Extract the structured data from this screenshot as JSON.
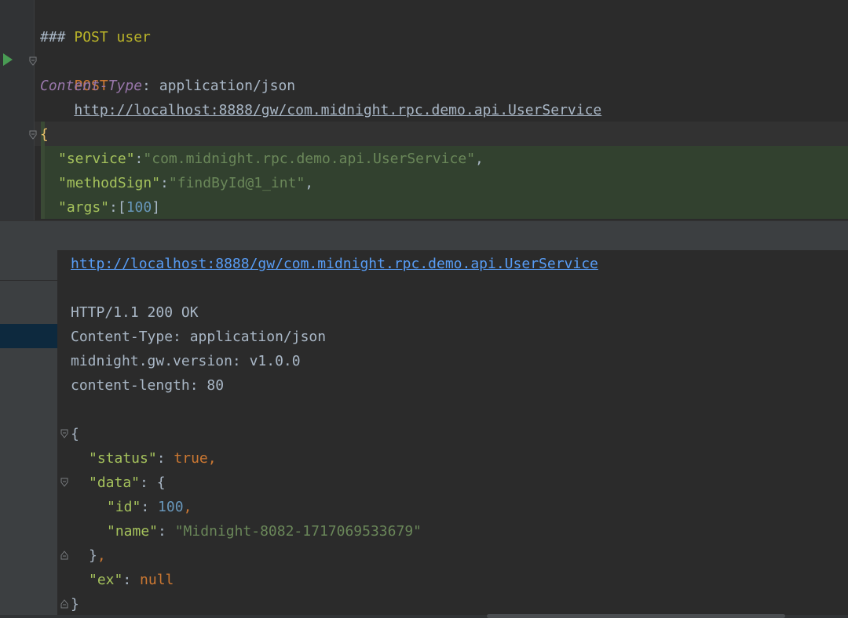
{
  "request": {
    "comment": "### POST user",
    "method": "POST",
    "url": "http://localhost:8888/gw/com.midnight.rpc.demo.api.UserService",
    "header_name": "Content-Type",
    "header_sep": ": ",
    "header_value": "application/json",
    "body_open": "{",
    "body_lines": [
      {
        "key": "\"service\"",
        "sep": ":",
        "value": "\"com.midnight.rpc.demo.api.UserService\"",
        "trail": ","
      },
      {
        "key": "\"methodSign\"",
        "sep": ":",
        "value": "\"findById@1_int\"",
        "trail": ","
      },
      {
        "key": "\"args\"",
        "sep": ":",
        "open": "[",
        "value": "100",
        "close": "]"
      }
    ]
  },
  "response": {
    "url": "http://localhost:8888/gw/com.midnight.rpc.demo.api.UserService",
    "status_line": "HTTP/1.1 200 OK",
    "headers": [
      "Content-Type: application/json",
      "midnight.gw.version: v1.0.0",
      "content-length: 80"
    ],
    "json": {
      "open": "{",
      "status_key": "\"status\"",
      "status_value": "true",
      "data_key": "\"data\"",
      "data_open": "{",
      "id_key": "\"id\"",
      "id_value": "100",
      "name_key": "\"name\"",
      "name_value": "\"Midnight-8082-1717069533679\"",
      "data_close": "}",
      "ex_key": "\"ex\"",
      "ex_value": "null",
      "close": "}"
    }
  },
  "icons": [
    "run-request-icon",
    "fold-icon",
    "fold-end-icon"
  ]
}
